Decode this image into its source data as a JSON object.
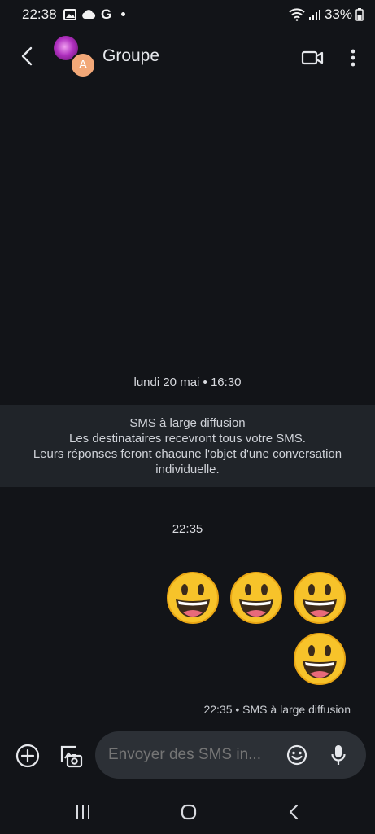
{
  "status_bar": {
    "time": "22:38",
    "left_icons": [
      "gallery-icon",
      "cloud-icon",
      "google-icon",
      "dot-icon"
    ],
    "google_letter": "G",
    "right_icons": [
      "wifi-icon",
      "signal-icon",
      "battery-icon"
    ],
    "battery": "33%"
  },
  "header": {
    "title": "Groupe",
    "avatar_letter": "A"
  },
  "conversation": {
    "date_day": "lundi 20 mai",
    "date_time": "• 16:30",
    "broadcast_info": {
      "line1": "SMS à large diffusion",
      "line2": "Les destinataires recevront tous votre SMS.",
      "line3": "Leurs réponses feront chacune l'objet d'une conversation",
      "line4": "individuelle."
    },
    "time_separator": "22:35",
    "message": {
      "emojis": [
        "😀",
        "😀",
        "😀",
        "😀"
      ],
      "meta": "22:35 • SMS à large diffusion"
    }
  },
  "compose": {
    "placeholder": "Envoyer des SMS in..."
  },
  "nav_bar": {
    "buttons": [
      "recent-apps",
      "home",
      "back"
    ]
  }
}
